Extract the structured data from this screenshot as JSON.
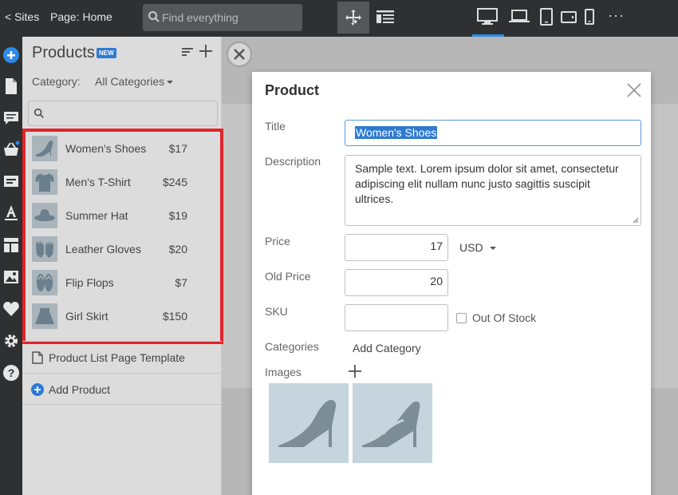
{
  "topbar": {
    "back_label": "< Sites",
    "page_label": "Page: Home",
    "search_placeholder": "Find everything",
    "more_label": "···"
  },
  "panel": {
    "title": "Products",
    "badge": "NEW",
    "category_label": "Category:",
    "category_value": "All Categories",
    "products": [
      {
        "name": "Women's Shoes",
        "price": "$17",
        "icon": "shoe-icon"
      },
      {
        "name": "Men's T-Shirt",
        "price": "$245",
        "icon": "tshirt-icon"
      },
      {
        "name": "Summer Hat",
        "price": "$19",
        "icon": "hat-icon"
      },
      {
        "name": "Leather Gloves",
        "price": "$20",
        "icon": "gloves-icon"
      },
      {
        "name": "Flip Flops",
        "price": "$7",
        "icon": "flipflops-icon"
      },
      {
        "name": "Girl Skirt",
        "price": "$150",
        "icon": "skirt-icon"
      }
    ],
    "template_link": "Product List Page Template",
    "add_product": "Add Product"
  },
  "modal": {
    "title": "Product",
    "title_label": "Title",
    "title_value": "Women's Shoes",
    "description_label": "Description",
    "description_value": "Sample text. Lorem ipsum dolor sit amet, consectetur adipiscing elit nullam nunc justo sagittis suscipit ultrices.",
    "price_label": "Price",
    "price_value": "17",
    "currency": "USD",
    "old_price_label": "Old Price",
    "old_price_value": "20",
    "sku_label": "SKU",
    "sku_value": "",
    "out_of_stock_label": "Out Of Stock",
    "categories_label": "Categories",
    "add_category": "Add Category",
    "images_label": "Images"
  },
  "colors": {
    "accent": "#2d8ae6",
    "highlight": "#e1242a",
    "topbar": "#2e3032"
  }
}
